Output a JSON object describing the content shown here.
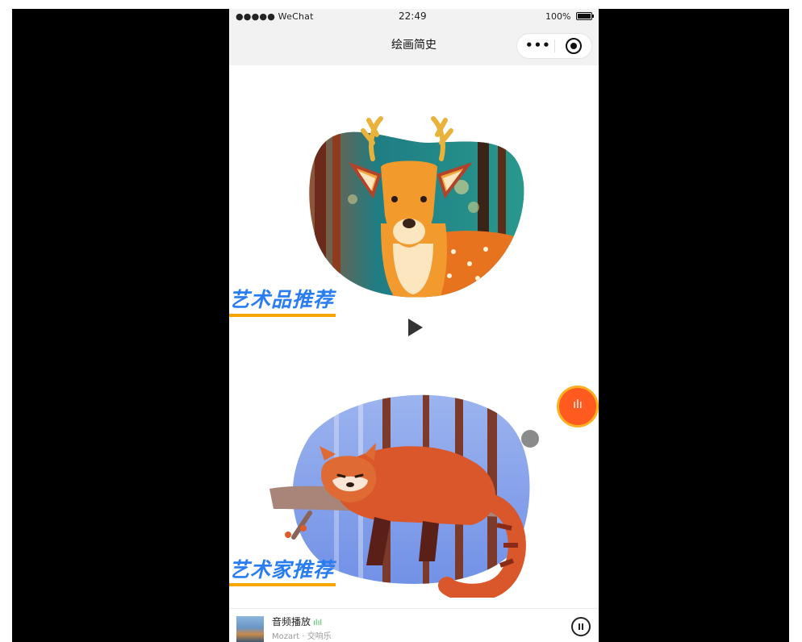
{
  "status_bar": {
    "carrier": "●●●●● WeChat",
    "time": "22:49",
    "battery": "100%"
  },
  "nav": {
    "title": "绘画简史",
    "more_icon": "more-dots-icon",
    "close_icon": "target-close-icon"
  },
  "sections": [
    {
      "heading": "艺术品推荐",
      "image": "deer-forest-illustration"
    },
    {
      "heading": "艺术家推荐",
      "image": "red-panda-branch-illustration"
    }
  ],
  "controls": {
    "play_icon": "play-icon",
    "audio_fab_icon": "audio-wave-icon"
  },
  "player": {
    "title": "音频播放",
    "subtitle": "Mozart · 交响乐",
    "pause_icon": "pause-icon"
  },
  "colors": {
    "heading": "#2a7df0",
    "underline": "#f5a600",
    "fab": "#ff5a1f",
    "fab_ring": "#ffb020"
  }
}
